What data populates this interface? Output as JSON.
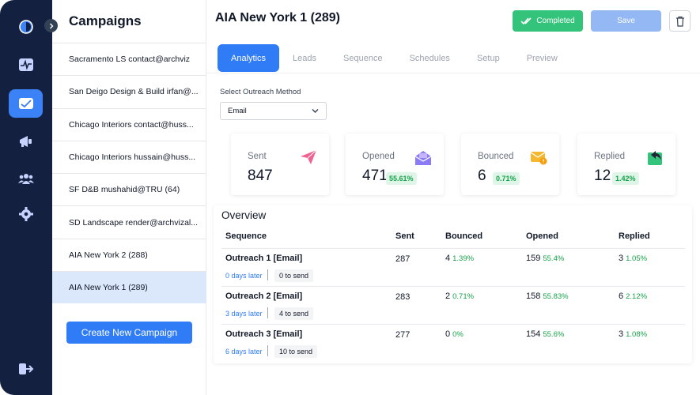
{
  "rail": {
    "items": [
      {
        "icon": "logo-icon"
      },
      {
        "icon": "activity-icon"
      },
      {
        "icon": "campaigns-mail-icon",
        "active": true
      },
      {
        "icon": "megaphone-icon"
      },
      {
        "icon": "users-icon"
      },
      {
        "icon": "settings-gear-icon"
      },
      {
        "icon": "logout-icon"
      }
    ]
  },
  "campaigns": {
    "title": "Campaigns",
    "items": [
      "Sacramento LS contact@archviz",
      "San Deigo Design & Build irfan@...",
      "Chicago Interiors contact@huss...",
      "Chicago Interiors hussain@huss...",
      "SF D&B mushahid@TRU (64)",
      "SD Landscape render@archvizal...",
      "AIA New York 2 (288)",
      "AIA New York 1 (289)"
    ],
    "selected_index": 7,
    "create_label": "Create New Campaign"
  },
  "header": {
    "title": "AIA New York 1 (289)",
    "completed_label": "Completed",
    "save_label": "Save"
  },
  "tabs": [
    "Analytics",
    "Leads",
    "Sequence",
    "Schedules",
    "Setup",
    "Preview"
  ],
  "active_tab": "Analytics",
  "outreach": {
    "label": "Select Outreach Method",
    "value": "Email"
  },
  "stats": {
    "sent": {
      "label": "Sent",
      "value": "847"
    },
    "opened": {
      "label": "Opened",
      "value": "471",
      "pct": "55.61%"
    },
    "bounced": {
      "label": "Bounced",
      "value": "6",
      "pct": "0.71%"
    },
    "replied": {
      "label": "Replied",
      "value": "12",
      "pct": "1.42%"
    }
  },
  "overview": {
    "title": "Overview",
    "headers": {
      "sequence": "Sequence",
      "sent": "Sent",
      "bounced": "Bounced",
      "opened": "Opened",
      "replied": "Replied"
    },
    "rows": [
      {
        "name": "Outreach 1 [Email]",
        "sent": "287",
        "bounced": "4",
        "bounced_pct": "1.39%",
        "opened": "159",
        "opened_pct": "55.4%",
        "replied": "3",
        "replied_pct": "1.05%",
        "delay": "0 days later",
        "to_send": "0 to send"
      },
      {
        "name": "Outreach 2 [Email]",
        "sent": "283",
        "bounced": "2",
        "bounced_pct": "0.71%",
        "opened": "158",
        "opened_pct": "55.83%",
        "replied": "6",
        "replied_pct": "2.12%",
        "delay": "3 days later",
        "to_send": "4 to send"
      },
      {
        "name": "Outreach 3 [Email]",
        "sent": "277",
        "bounced": "0",
        "bounced_pct": "0%",
        "opened": "154",
        "opened_pct": "55.6%",
        "replied": "3",
        "replied_pct": "1.08%",
        "delay": "6 days later",
        "to_send": "10 to send"
      }
    ]
  },
  "colors": {
    "primary": "#2f7cf6",
    "success": "#34c37b",
    "rail": "#13203f"
  }
}
